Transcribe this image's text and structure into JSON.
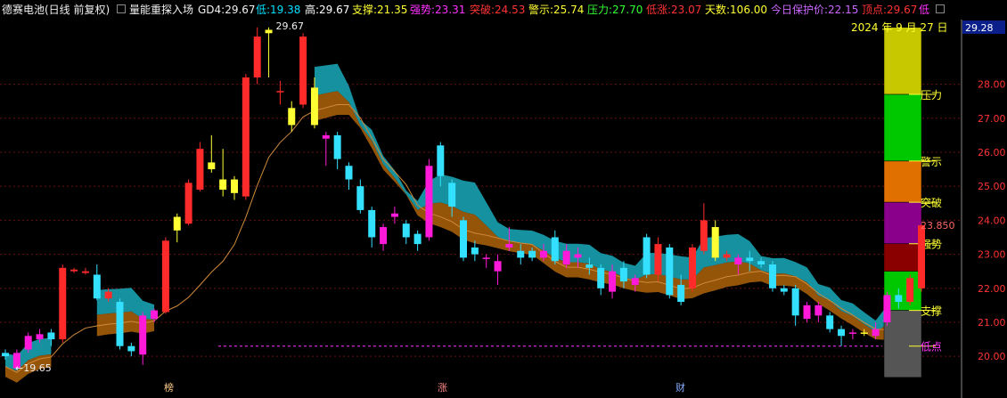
{
  "header": {
    "stock_name": "德赛电池",
    "period_label": "(日线 前复权)",
    "indicator_name": "量能重探入场",
    "items": [
      {
        "label": "GD4:",
        "value": "29.67",
        "color": "#f0f0f0"
      },
      {
        "label": "低:",
        "value": "19.38",
        "color": "#00e0ff"
      },
      {
        "label": "高:",
        "value": "29.67",
        "color": "#ffffff"
      },
      {
        "label": "支撑:",
        "value": "21.35",
        "color": "#ffff33"
      },
      {
        "label": "强势:",
        "value": "23.31",
        "color": "#ff33ff"
      },
      {
        "label": "突破:",
        "value": "24.53",
        "color": "#ff3333"
      },
      {
        "label": "警示:",
        "value": "25.74",
        "color": "#ffff33"
      },
      {
        "label": "压力:",
        "value": "27.70",
        "color": "#33ff33"
      },
      {
        "label": "低涨:",
        "value": "23.07",
        "color": "#ff3333"
      },
      {
        "label": "天数:",
        "value": "106.00",
        "color": "#ffff33"
      },
      {
        "label": "今日保护价:",
        "value": "22.15",
        "color": "#cc66ff"
      },
      {
        "label": "顶点:",
        "value": "29.67",
        "color": "#ff3333"
      },
      {
        "label": "低",
        "value": "",
        "color": "#ff33ff"
      }
    ]
  },
  "date_label": "2024 年 9 月 27 日",
  "current_price_tag": "29.28",
  "right_price_tag": "23.850",
  "annotations": {
    "high": "29.67",
    "low": "19.65"
  },
  "zone_labels": [
    {
      "text": "压力",
      "price": 27.7,
      "color": "#ffff33"
    },
    {
      "text": "警示",
      "price": 25.74,
      "color": "#ffff33"
    },
    {
      "text": "突破",
      "price": 24.53,
      "color": "#ffff33"
    },
    {
      "text": "强势",
      "price": 23.31,
      "color": "#ffff33"
    },
    {
      "text": "支撑",
      "price": 21.35,
      "color": "#ffff33"
    },
    {
      "text": "低点",
      "price": 20.3,
      "color": "#ff33ff"
    }
  ],
  "bottom_markers": [
    {
      "text": "榜",
      "x": 190,
      "color": "#ffcc88"
    },
    {
      "text": "涨",
      "x": 497,
      "color": "#ff8888"
    },
    {
      "text": "财",
      "x": 764,
      "color": "#88aaff"
    }
  ],
  "colors": {
    "up": "#ff2a2a",
    "down": "#33e0ff",
    "magenta": "#ff1ad9",
    "yellow": "#ffff33",
    "teal": "#1799a8",
    "brown": "#9c5a0a",
    "grid": "#6a1010",
    "axis_text": "#ff3333"
  },
  "chart_data": {
    "type": "candlestick",
    "yticks": [
      20.0,
      21.0,
      22.0,
      23.0,
      24.0,
      25.0,
      26.0,
      27.0,
      28.0
    ],
    "ylim": [
      19.35,
      29.9
    ],
    "support_line": 20.3,
    "zones": [
      {
        "from": 27.7,
        "to": 29.67,
        "color": "#c8c800"
      },
      {
        "from": 25.74,
        "to": 27.7,
        "color": "#00c800"
      },
      {
        "from": 24.53,
        "to": 25.74,
        "color": "#e07000"
      },
      {
        "from": 23.31,
        "to": 24.53,
        "color": "#8a008a"
      },
      {
        "from": 22.5,
        "to": 23.31,
        "color": "#8a0000"
      },
      {
        "from": 21.35,
        "to": 22.5,
        "color": "#00c800"
      },
      {
        "from": 19.38,
        "to": 21.35,
        "color": "#555555"
      }
    ],
    "candles": [
      {
        "o": 20.1,
        "c": 20.0,
        "h": 20.2,
        "l": 19.9,
        "t": "down"
      },
      {
        "o": 20.1,
        "c": 19.65,
        "h": 20.2,
        "l": 19.6,
        "t": "mag"
      },
      {
        "o": 20.2,
        "c": 20.6,
        "h": 20.7,
        "l": 20.1,
        "t": "mag"
      },
      {
        "o": 20.5,
        "c": 20.65,
        "h": 20.8,
        "l": 20.4,
        "t": "mag"
      },
      {
        "o": 20.7,
        "c": 20.5,
        "h": 20.8,
        "l": 20.3,
        "t": "down"
      },
      {
        "o": 20.5,
        "c": 22.6,
        "h": 22.7,
        "l": 20.4,
        "t": "up"
      },
      {
        "o": 22.5,
        "c": 22.55,
        "h": 22.6,
        "l": 22.45,
        "t": "up"
      },
      {
        "o": 22.45,
        "c": 22.5,
        "h": 22.6,
        "l": 22.4,
        "t": "up"
      },
      {
        "o": 22.4,
        "c": 21.7,
        "h": 22.7,
        "l": 21.65,
        "t": "down"
      },
      {
        "o": 21.9,
        "c": 21.7,
        "h": 22.0,
        "l": 21.6,
        "t": "up"
      },
      {
        "o": 21.6,
        "c": 20.3,
        "h": 21.7,
        "l": 20.2,
        "t": "down"
      },
      {
        "o": 20.3,
        "c": 20.15,
        "h": 20.4,
        "l": 20.0,
        "t": "down"
      },
      {
        "o": 21.2,
        "c": 20.05,
        "h": 21.3,
        "l": 19.75,
        "t": "mag"
      },
      {
        "o": 21.1,
        "c": 21.35,
        "h": 21.4,
        "l": 21.0,
        "t": "mag"
      },
      {
        "o": 21.3,
        "c": 23.4,
        "h": 23.5,
        "l": 21.25,
        "t": "up"
      },
      {
        "o": 23.7,
        "c": 24.1,
        "h": 24.2,
        "l": 23.35,
        "t": "yel"
      },
      {
        "o": 23.9,
        "c": 25.1,
        "h": 25.2,
        "l": 23.85,
        "t": "up"
      },
      {
        "o": 24.9,
        "c": 26.1,
        "h": 26.3,
        "l": 24.85,
        "t": "up"
      },
      {
        "o": 25.7,
        "c": 25.5,
        "h": 26.5,
        "l": 25.4,
        "t": "yel"
      },
      {
        "o": 25.2,
        "c": 24.9,
        "h": 26.1,
        "l": 24.7,
        "t": "yel"
      },
      {
        "o": 24.8,
        "c": 25.2,
        "h": 25.3,
        "l": 24.6,
        "t": "yel"
      },
      {
        "o": 24.7,
        "c": 28.2,
        "h": 28.3,
        "l": 24.6,
        "t": "up"
      },
      {
        "o": 28.2,
        "c": 29.4,
        "h": 29.67,
        "l": 28.0,
        "t": "up"
      },
      {
        "o": 29.5,
        "c": 29.6,
        "h": 29.67,
        "l": 28.2,
        "t": "yel"
      },
      {
        "o": 27.8,
        "c": 27.8,
        "h": 28.1,
        "l": 27.4,
        "t": "up"
      },
      {
        "o": 26.8,
        "c": 27.3,
        "h": 27.5,
        "l": 26.6,
        "t": "yel"
      },
      {
        "o": 27.4,
        "c": 29.4,
        "h": 29.5,
        "l": 27.3,
        "t": "up"
      },
      {
        "o": 26.8,
        "c": 27.9,
        "h": 28.2,
        "l": 26.7,
        "t": "yel"
      },
      {
        "o": 26.5,
        "c": 26.4,
        "h": 26.6,
        "l": 25.6,
        "t": "mag"
      },
      {
        "o": 26.5,
        "c": 25.8,
        "h": 26.6,
        "l": 25.5,
        "t": "down"
      },
      {
        "o": 25.6,
        "c": 25.2,
        "h": 25.7,
        "l": 24.9,
        "t": "down"
      },
      {
        "o": 25.0,
        "c": 24.3,
        "h": 25.2,
        "l": 24.2,
        "t": "down"
      },
      {
        "o": 24.3,
        "c": 23.5,
        "h": 24.4,
        "l": 23.2,
        "t": "down"
      },
      {
        "o": 23.8,
        "c": 23.3,
        "h": 23.9,
        "l": 23.1,
        "t": "mag"
      },
      {
        "o": 24.1,
        "c": 24.2,
        "h": 24.4,
        "l": 23.9,
        "t": "mag"
      },
      {
        "o": 23.9,
        "c": 23.5,
        "h": 24.0,
        "l": 23.3,
        "t": "down"
      },
      {
        "o": 23.6,
        "c": 23.3,
        "h": 23.7,
        "l": 23.1,
        "t": "down"
      },
      {
        "o": 23.5,
        "c": 25.6,
        "h": 25.8,
        "l": 23.4,
        "t": "mag"
      },
      {
        "o": 26.2,
        "c": 25.3,
        "h": 26.3,
        "l": 25.0,
        "t": "down"
      },
      {
        "o": 25.1,
        "c": 24.4,
        "h": 25.2,
        "l": 24.1,
        "t": "down"
      },
      {
        "o": 24.0,
        "c": 22.9,
        "h": 24.1,
        "l": 22.8,
        "t": "down"
      },
      {
        "o": 23.0,
        "c": 23.2,
        "h": 23.4,
        "l": 22.8,
        "t": "down"
      },
      {
        "o": 22.9,
        "c": 22.9,
        "h": 23.0,
        "l": 22.6,
        "t": "mag"
      },
      {
        "o": 22.8,
        "c": 22.5,
        "h": 23.0,
        "l": 22.1,
        "t": "mag"
      },
      {
        "o": 23.2,
        "c": 23.3,
        "h": 23.8,
        "l": 23.1,
        "t": "mag"
      },
      {
        "o": 23.1,
        "c": 22.9,
        "h": 23.3,
        "l": 22.7,
        "t": "down"
      },
      {
        "o": 23.1,
        "c": 22.9,
        "h": 23.2,
        "l": 22.8,
        "t": "down"
      },
      {
        "o": 22.9,
        "c": 23.1,
        "h": 23.3,
        "l": 22.8,
        "t": "mag"
      },
      {
        "o": 23.5,
        "c": 22.8,
        "h": 23.7,
        "l": 22.7,
        "t": "down"
      },
      {
        "o": 23.1,
        "c": 22.7,
        "h": 23.3,
        "l": 22.6,
        "t": "mag"
      },
      {
        "o": 23.0,
        "c": 22.9,
        "h": 23.2,
        "l": 22.6,
        "t": "mag"
      },
      {
        "o": 22.7,
        "c": 22.6,
        "h": 22.9,
        "l": 22.4,
        "t": "down"
      },
      {
        "o": 22.6,
        "c": 22.0,
        "h": 22.7,
        "l": 21.8,
        "t": "down"
      },
      {
        "o": 22.5,
        "c": 21.9,
        "h": 22.7,
        "l": 21.7,
        "t": "mag"
      },
      {
        "o": 22.6,
        "c": 22.2,
        "h": 22.8,
        "l": 22.0,
        "t": "down"
      },
      {
        "o": 22.3,
        "c": 22.1,
        "h": 22.4,
        "l": 21.9,
        "t": "mag"
      },
      {
        "o": 23.5,
        "c": 22.4,
        "h": 23.6,
        "l": 22.3,
        "t": "down"
      },
      {
        "o": 22.4,
        "c": 23.3,
        "h": 23.5,
        "l": 22.2,
        "t": "up"
      },
      {
        "o": 23.2,
        "c": 21.8,
        "h": 23.3,
        "l": 21.7,
        "t": "down"
      },
      {
        "o": 22.1,
        "c": 21.6,
        "h": 22.4,
        "l": 21.5,
        "t": "down"
      },
      {
        "o": 22.0,
        "c": 23.2,
        "h": 23.3,
        "l": 21.9,
        "t": "up"
      },
      {
        "o": 23.1,
        "c": 24.0,
        "h": 24.5,
        "l": 23.0,
        "t": "up"
      },
      {
        "o": 23.8,
        "c": 22.9,
        "h": 24.0,
        "l": 22.8,
        "t": "yel"
      },
      {
        "o": 23.0,
        "c": 22.9,
        "h": 23.1,
        "l": 22.8,
        "t": "up"
      },
      {
        "o": 22.9,
        "c": 22.7,
        "h": 23.0,
        "l": 22.4,
        "t": "mag"
      },
      {
        "o": 22.8,
        "c": 22.9,
        "h": 23.1,
        "l": 22.5,
        "t": "down"
      },
      {
        "o": 22.8,
        "c": 22.7,
        "h": 22.9,
        "l": 22.6,
        "t": "down"
      },
      {
        "o": 22.7,
        "c": 22.0,
        "h": 22.8,
        "l": 21.9,
        "t": "down"
      },
      {
        "o": 22.0,
        "c": 21.9,
        "h": 22.1,
        "l": 21.8,
        "t": "down"
      },
      {
        "o": 22.0,
        "c": 21.2,
        "h": 22.1,
        "l": 20.9,
        "t": "down"
      },
      {
        "o": 21.5,
        "c": 21.1,
        "h": 21.6,
        "l": 21.0,
        "t": "mag"
      },
      {
        "o": 21.5,
        "c": 21.2,
        "h": 21.6,
        "l": 21.0,
        "t": "mag"
      },
      {
        "o": 21.2,
        "c": 20.8,
        "h": 21.3,
        "l": 20.7,
        "t": "down"
      },
      {
        "o": 20.8,
        "c": 20.6,
        "h": 20.9,
        "l": 20.3,
        "t": "down"
      },
      {
        "o": 20.7,
        "c": 20.7,
        "h": 20.8,
        "l": 20.5,
        "t": "mag"
      },
      {
        "o": 20.7,
        "c": 20.7,
        "h": 20.8,
        "l": 20.6,
        "t": "yel"
      },
      {
        "o": 20.6,
        "c": 20.8,
        "h": 21.0,
        "l": 20.5,
        "t": "mag"
      },
      {
        "o": 21.0,
        "c": 21.8,
        "h": 21.9,
        "l": 20.9,
        "t": "mag"
      },
      {
        "o": 21.8,
        "c": 21.6,
        "h": 22.0,
        "l": 21.4,
        "t": "down"
      },
      {
        "o": 21.6,
        "c": 22.3,
        "h": 22.4,
        "l": 21.5,
        "t": "up"
      },
      {
        "o": 22.0,
        "c": 23.85,
        "h": 23.9,
        "l": 21.9,
        "t": "up"
      }
    ]
  }
}
